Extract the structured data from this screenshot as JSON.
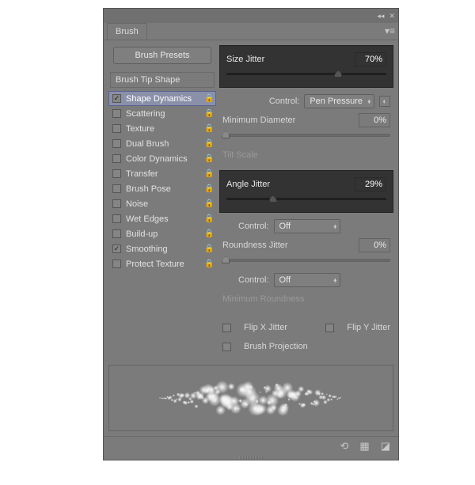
{
  "header": {
    "collapse": "◂◂",
    "close": "✕"
  },
  "tab": {
    "title": "Brush",
    "menu": "▾≡"
  },
  "left": {
    "presets_btn": "Brush Presets",
    "tip_shape": "Brush Tip Shape",
    "options": [
      {
        "label": "Shape Dynamics",
        "checked": true,
        "selected": true,
        "lock": true
      },
      {
        "label": "Scattering",
        "checked": false,
        "selected": false,
        "lock": true
      },
      {
        "label": "Texture",
        "checked": false,
        "selected": false,
        "lock": true
      },
      {
        "label": "Dual Brush",
        "checked": false,
        "selected": false,
        "lock": true
      },
      {
        "label": "Color Dynamics",
        "checked": false,
        "selected": false,
        "lock": true
      },
      {
        "label": "Transfer",
        "checked": false,
        "selected": false,
        "lock": true
      },
      {
        "label": "Brush Pose",
        "checked": false,
        "selected": false,
        "lock": true
      },
      {
        "label": "Noise",
        "checked": false,
        "selected": false,
        "lock": true
      },
      {
        "label": "Wet Edges",
        "checked": false,
        "selected": false,
        "lock": true
      },
      {
        "label": "Build-up",
        "checked": false,
        "selected": false,
        "lock": true
      },
      {
        "label": "Smoothing",
        "checked": true,
        "selected": false,
        "lock": true
      },
      {
        "label": "Protect Texture",
        "checked": false,
        "selected": false,
        "lock": true
      }
    ]
  },
  "right": {
    "size_jitter": {
      "label": "Size Jitter",
      "value": "70%",
      "thumb": 70
    },
    "size_control_label": "Control:",
    "size_control_value": "Pen Pressure",
    "min_diameter": {
      "label": "Minimum Diameter",
      "value": "0%",
      "thumb": 0
    },
    "tilt_scale": {
      "label": "Tilt Scale"
    },
    "angle_jitter": {
      "label": "Angle Jitter",
      "value": "29%",
      "thumb": 29
    },
    "angle_control_label": "Control:",
    "angle_control_value": "Off",
    "round_jitter": {
      "label": "Roundness Jitter",
      "value": "0%",
      "thumb": 0
    },
    "round_control_label": "Control:",
    "round_control_value": "Off",
    "min_round": {
      "label": "Minimum Roundness"
    },
    "flip_x": "Flip X Jitter",
    "flip_y": "Flip Y Jitter",
    "brush_proj": "Brush Projection"
  },
  "footer": {
    "a": "⟲",
    "b": "▦",
    "c": "◪"
  }
}
